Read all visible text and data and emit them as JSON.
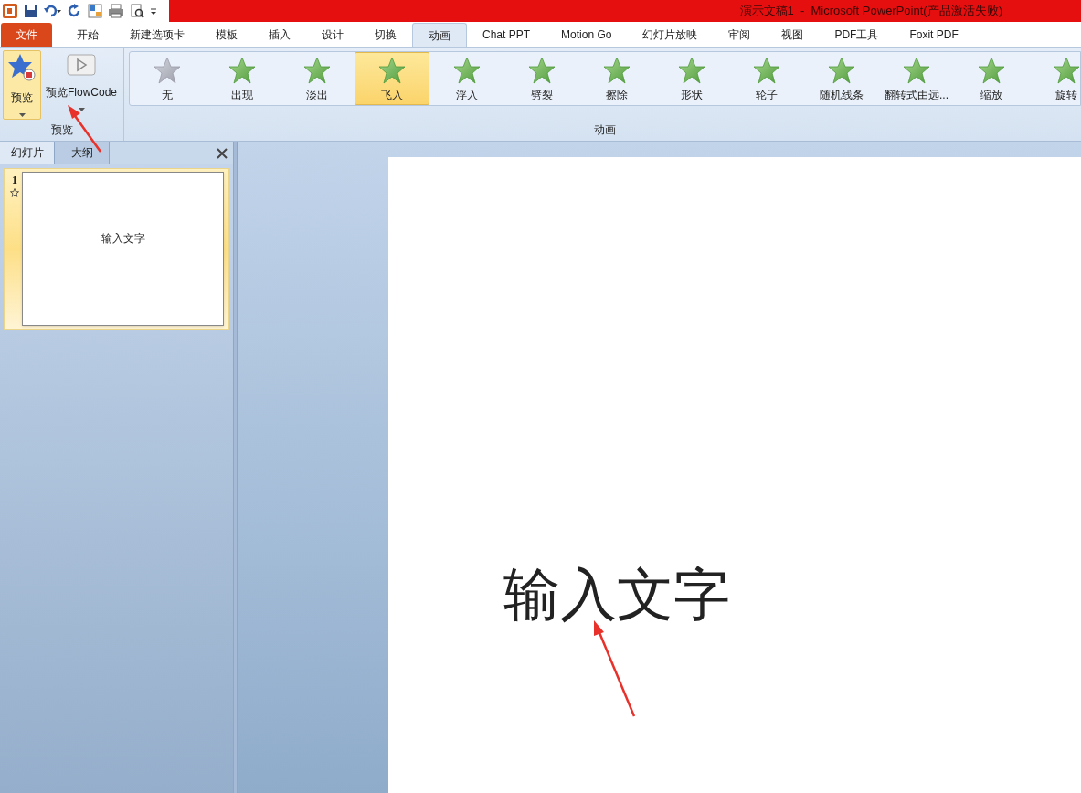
{
  "window": {
    "title": "演示文稿1  -  Microsoft PowerPoint(产品激活失败)"
  },
  "file_tab": "文件",
  "tabs": [
    {
      "label": "开始",
      "selected": false
    },
    {
      "label": "新建选项卡",
      "selected": false
    },
    {
      "label": "模板",
      "selected": false
    },
    {
      "label": "插入",
      "selected": false
    },
    {
      "label": "设计",
      "selected": false
    },
    {
      "label": "切换",
      "selected": false
    },
    {
      "label": "动画",
      "selected": true
    },
    {
      "label": "Chat PPT",
      "selected": false
    },
    {
      "label": "Motion Go",
      "selected": false
    },
    {
      "label": "幻灯片放映",
      "selected": false
    },
    {
      "label": "审阅",
      "selected": false
    },
    {
      "label": "视图",
      "selected": false
    },
    {
      "label": "PDF工具",
      "selected": false
    },
    {
      "label": "Foxit PDF",
      "selected": false
    }
  ],
  "preview_group": {
    "label": "预览",
    "buttons": [
      {
        "label": "预览",
        "kind": "star",
        "selected": true
      },
      {
        "label": "预览FlowCode",
        "kind": "play",
        "selected": false
      }
    ]
  },
  "animation_group": {
    "label": "动画",
    "effects": [
      {
        "label": "无",
        "kind": "none",
        "selected": false
      },
      {
        "label": "出现",
        "kind": "effect",
        "selected": false
      },
      {
        "label": "淡出",
        "kind": "effect",
        "selected": false
      },
      {
        "label": "飞入",
        "kind": "effect",
        "selected": true
      },
      {
        "label": "浮入",
        "kind": "effect",
        "selected": false
      },
      {
        "label": "劈裂",
        "kind": "effect",
        "selected": false
      },
      {
        "label": "擦除",
        "kind": "effect",
        "selected": false
      },
      {
        "label": "形状",
        "kind": "effect",
        "selected": false
      },
      {
        "label": "轮子",
        "kind": "effect",
        "selected": false
      },
      {
        "label": "随机线条",
        "kind": "effect",
        "selected": false
      },
      {
        "label": "翻转式由远...",
        "kind": "effect",
        "selected": false
      },
      {
        "label": "缩放",
        "kind": "effect",
        "selected": false
      },
      {
        "label": "旋转",
        "kind": "effect",
        "selected": false
      }
    ]
  },
  "pane_tabs": [
    {
      "label": "幻灯片",
      "selected": true
    },
    {
      "label": "大纲",
      "selected": false
    }
  ],
  "slides": [
    {
      "number": "1",
      "text": "输入文字",
      "selected": true
    }
  ],
  "slide": {
    "text": "输入文字"
  }
}
